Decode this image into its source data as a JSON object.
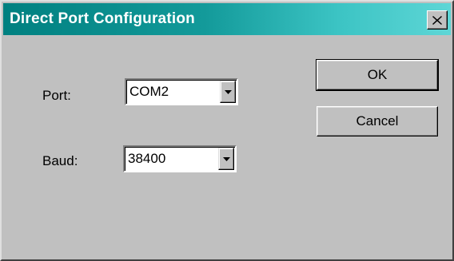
{
  "window": {
    "title": "Direct Port Configuration",
    "close_icon": "close-x-icon"
  },
  "form": {
    "port_label": "Port:",
    "port_value": "COM2",
    "baud_label": "Baud:",
    "baud_value": "38400",
    "dropdown_icon": "triangle-down-icon"
  },
  "buttons": {
    "ok_label": "OK",
    "cancel_label": "Cancel"
  },
  "colors": {
    "titlebar_start": "#008080",
    "titlebar_end": "#5ed6d6",
    "face": "#c0c0c0"
  }
}
